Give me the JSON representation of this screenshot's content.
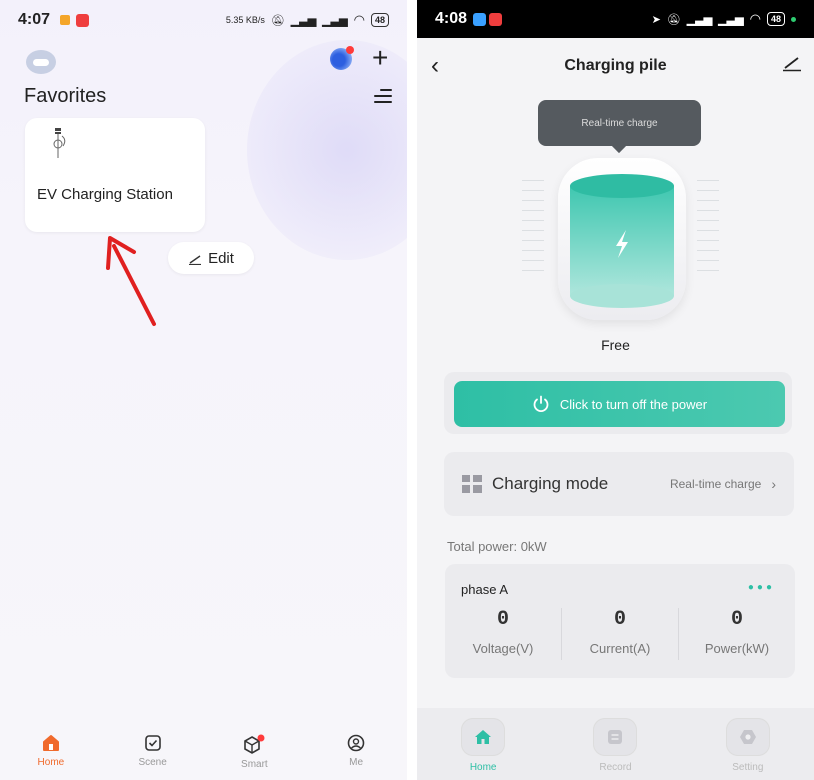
{
  "left": {
    "status": {
      "time": "4:07",
      "speed": "5.35 KB/s",
      "battery": "48"
    },
    "favorites_title": "Favorites",
    "device_card": {
      "name": "EV Charging Station"
    },
    "edit_label": "Edit",
    "tabs": [
      {
        "label": "Home",
        "icon": "home-icon"
      },
      {
        "label": "Scene",
        "icon": "checkbox-icon"
      },
      {
        "label": "Smart",
        "icon": "smart-cube-icon"
      },
      {
        "label": "Me",
        "icon": "profile-icon"
      }
    ],
    "colors": {
      "accent": "#f06a2c",
      "arrow": "#e02020"
    }
  },
  "right": {
    "status": {
      "time": "4:08",
      "battery": "48"
    },
    "title": "Charging pile",
    "tooltip": "Real-time charge",
    "state": "Free",
    "power_button": "Click to turn off the power",
    "charging_mode": {
      "label": "Charging mode",
      "value": "Real-time charge"
    },
    "total_power": "Total power:  0kW",
    "phase": {
      "name": "phase A",
      "metrics": [
        {
          "value": "0",
          "label": "Voltage(V)"
        },
        {
          "value": "0",
          "label": "Current(A)"
        },
        {
          "value": "0",
          "label": "Power(kW)"
        }
      ]
    },
    "tabs": [
      {
        "label": "Home",
        "icon": "home-icon"
      },
      {
        "label": "Record",
        "icon": "record-icon"
      },
      {
        "label": "Setting",
        "icon": "setting-icon"
      }
    ],
    "colors": {
      "accent": "#2ebfa5"
    }
  }
}
